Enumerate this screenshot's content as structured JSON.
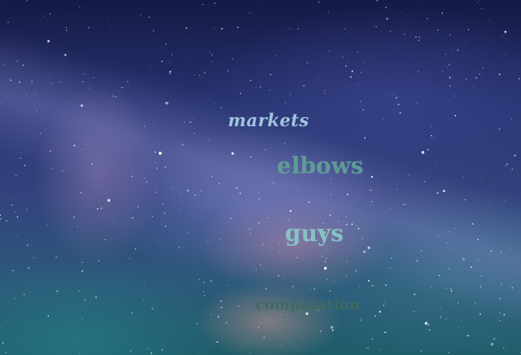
{
  "words": {
    "markets": "markets",
    "elbows": "elbows",
    "guys": "guys",
    "computation": "computation"
  },
  "colors": {
    "markets": "#9fc6de",
    "elbows": "#5f9c95",
    "guys": "#86c2c4",
    "computation": "#41695f"
  }
}
